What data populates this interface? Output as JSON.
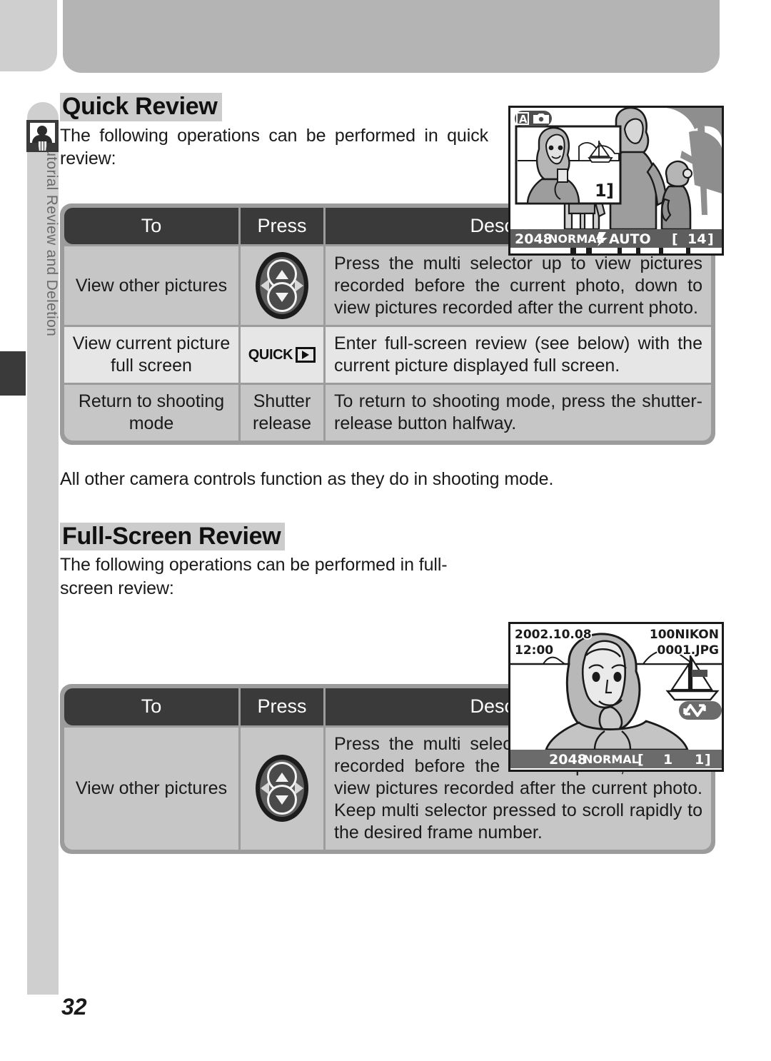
{
  "sidebar": {
    "label": "Tutorial Review and Deletion",
    "icon": "person-trash-icon"
  },
  "page": {
    "number": "32"
  },
  "sections": [
    {
      "heading": "Quick Review",
      "intro": "The following operations can be performed in quick review:",
      "outro": "All other camera controls function as they do in shooting mode.",
      "table": {
        "headers": [
          "To",
          "Press",
          "Description"
        ],
        "rows": [
          {
            "to": "View other pictures",
            "press": "multi-selector",
            "press_label": "",
            "description": "Press the multi selector up to view pictures recorded before the current photo, down to view pictures recorded after the current photo."
          },
          {
            "to": "View current picture full screen",
            "press": "quick-playback-button",
            "press_label": "QUICK",
            "description": "Enter full-screen review (see below) with the current picture displayed full screen."
          },
          {
            "to": "Return to shooting mode",
            "press": "text",
            "press_label": "Shutter release",
            "description": "To return to shooting mode, press the shutter-release button halfway."
          }
        ]
      },
      "lcd": {
        "mode_badge": "A",
        "mode_icon": "camera-icon",
        "thumb_counter": "1",
        "status_resolution": "2048",
        "status_quality": "NORMAL",
        "status_flash": "AUTO",
        "status_flash_icon": "flash-icon",
        "status_frames": "14"
      }
    },
    {
      "heading": "Full-Screen Review",
      "intro": "The following operations can be performed in full-screen review:",
      "outro": "",
      "table": {
        "headers": [
          "To",
          "Press",
          "Description"
        ],
        "rows": [
          {
            "to": "View other pictures",
            "press": "multi-selector",
            "press_label": "",
            "description": "Press the multi selector up to view pictures recorded before the current photo, down to view pictures recorded after the current photo.  Keep multi selector pressed to scroll rapidly to the desired frame number."
          }
        ]
      },
      "lcd": {
        "date": "2002.10.08",
        "time": "12:00",
        "folder": "100NIKON",
        "filename": "0001.JPG",
        "scroll_icon": "scroll-arrows-icon",
        "status_resolution": "2048",
        "status_quality": "NORMAL",
        "status_frame_current": "1",
        "status_frame_total": "1"
      }
    }
  ],
  "colors": {
    "header_bg": "#3a3a3a",
    "table_border": "#9c9c9c",
    "row_dark": "#c6c6c6",
    "row_light": "#e6e6e6",
    "banner": "#b4b4b4",
    "sidebar": "#cfcfcf",
    "heading_highlight": "#cccccc"
  }
}
